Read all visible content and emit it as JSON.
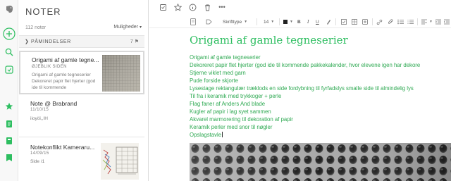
{
  "app": {
    "name": "Evernote",
    "accent": "#2dbe60"
  },
  "rail": {
    "items": [
      {
        "name": "elephant-logo-icon"
      },
      {
        "name": "new-note-icon"
      },
      {
        "name": "search-icon"
      },
      {
        "name": "work-chat-icon"
      },
      {
        "name": "shortcuts-star-icon"
      },
      {
        "name": "notes-icon"
      },
      {
        "name": "notebooks-icon"
      },
      {
        "name": "tags-icon"
      }
    ]
  },
  "list": {
    "title": "NOTER",
    "count": "112 noter",
    "options": "Muligheder",
    "reminders": {
      "label": "PÅMINDELSER",
      "icons": "7 ⚑"
    },
    "notes": [
      {
        "title": "Origami af gamle tegne...",
        "meta": "ØJEBLIK SIDEN",
        "snippet": "Origami af gamle tegneserier Dekoreret papir flet hjerter (god ide til kommende",
        "selected": true,
        "thumb": "grid"
      },
      {
        "title": "Note @ Brabrand",
        "meta": "11/10/15",
        "snippet": "iioyöi,,IH",
        "selected": false,
        "thumb": null
      },
      {
        "title": "Notekonflikt Kameraru...",
        "meta": "14/09/15",
        "snippet": "Side /1",
        "selected": false,
        "thumb": "sketch"
      }
    ]
  },
  "editor": {
    "toolbar": {
      "font": "Skrifttype",
      "size": "14"
    },
    "title": "Origami af gamle tegneserier",
    "body": [
      "Origami af gamle tegneserier",
      "Dekoreret papir  flet hjerter (god ide til kommende pakkekalender, hvor elevene igen har dekore",
      "Stjerne  viklet med garn",
      "Pude forside skjorte",
      "Lysestage rektangulær træklods en side fordybning til fyrfadslys smalle side til almindelig lys",
      "Til fra i keramik med trykkoger + perle",
      "Flag faner af Anders And blade",
      "Kugler af papir i lag syet sammen",
      "Akvarel marmorering til dekoration af papir",
      "Keramik perler med snor til nøgler",
      "Opslagstavle"
    ]
  }
}
